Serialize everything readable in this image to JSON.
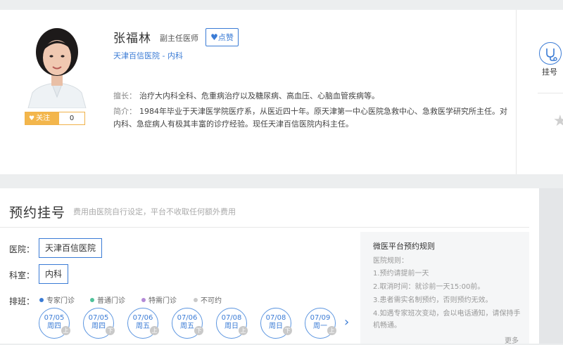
{
  "doctor": {
    "name": "张福林",
    "title": "副主任医师",
    "like_label": "点赞",
    "hospital_dept": "天津百信医院 - 内科",
    "follow_label": "关注",
    "follow_count": "0",
    "specialty_label": "擅长：",
    "specialty": "治疗大内科全科、危重病治疗以及糖尿病、高血压、心脑血管疾病等。",
    "intro_label": "简介：",
    "intro": "1984年毕业于天津医学院医疗系，从医近四十年。原天津第一中心医院急救中心、急救医学研究所主任。对内科、急症病人有极其丰富的诊疗经验。现任天津百信医院内科主任。"
  },
  "side": {
    "register_label": "挂号"
  },
  "booking": {
    "title": "预约挂号",
    "subtitle": "费用由医院自行设定，平台不收取任何额外费用",
    "hospital_label": "医院：",
    "hospital_value": "天津百信医院",
    "dept_label": "科室：",
    "dept_value": "内科",
    "schedule_label": "排班：",
    "legend": [
      {
        "label": "专家门诊",
        "color": "#3a7bd5"
      },
      {
        "label": "普通门诊",
        "color": "#4fc29a"
      },
      {
        "label": "特需门诊",
        "color": "#b38ad6"
      },
      {
        "label": "不可约",
        "color": "#c9c9c9"
      }
    ],
    "days": [
      {
        "date": "07/05",
        "week": "周四",
        "half": "上"
      },
      {
        "date": "07/05",
        "week": "周四",
        "half": "下"
      },
      {
        "date": "07/06",
        "week": "周五",
        "half": "上"
      },
      {
        "date": "07/06",
        "week": "周五",
        "half": "下"
      },
      {
        "date": "07/08",
        "week": "周日",
        "half": "上"
      },
      {
        "date": "07/08",
        "week": "周日",
        "half": "下"
      },
      {
        "date": "07/09",
        "week": "周一",
        "half": "上"
      }
    ]
  },
  "rules": {
    "title": "微医平台预约规则",
    "subtitle": "医院规则：",
    "items": [
      "1.预约请提前一天",
      "2.取消时间：就诊前一天15:00前。",
      "3.患者需实名制预约，否则预约无效。",
      "4.如遇专家班次变动，会以电话通知，请保持手机畅通。"
    ],
    "more": "更多"
  },
  "colors": {
    "accent": "#3a7bd5",
    "follow": "#f3b64c"
  }
}
